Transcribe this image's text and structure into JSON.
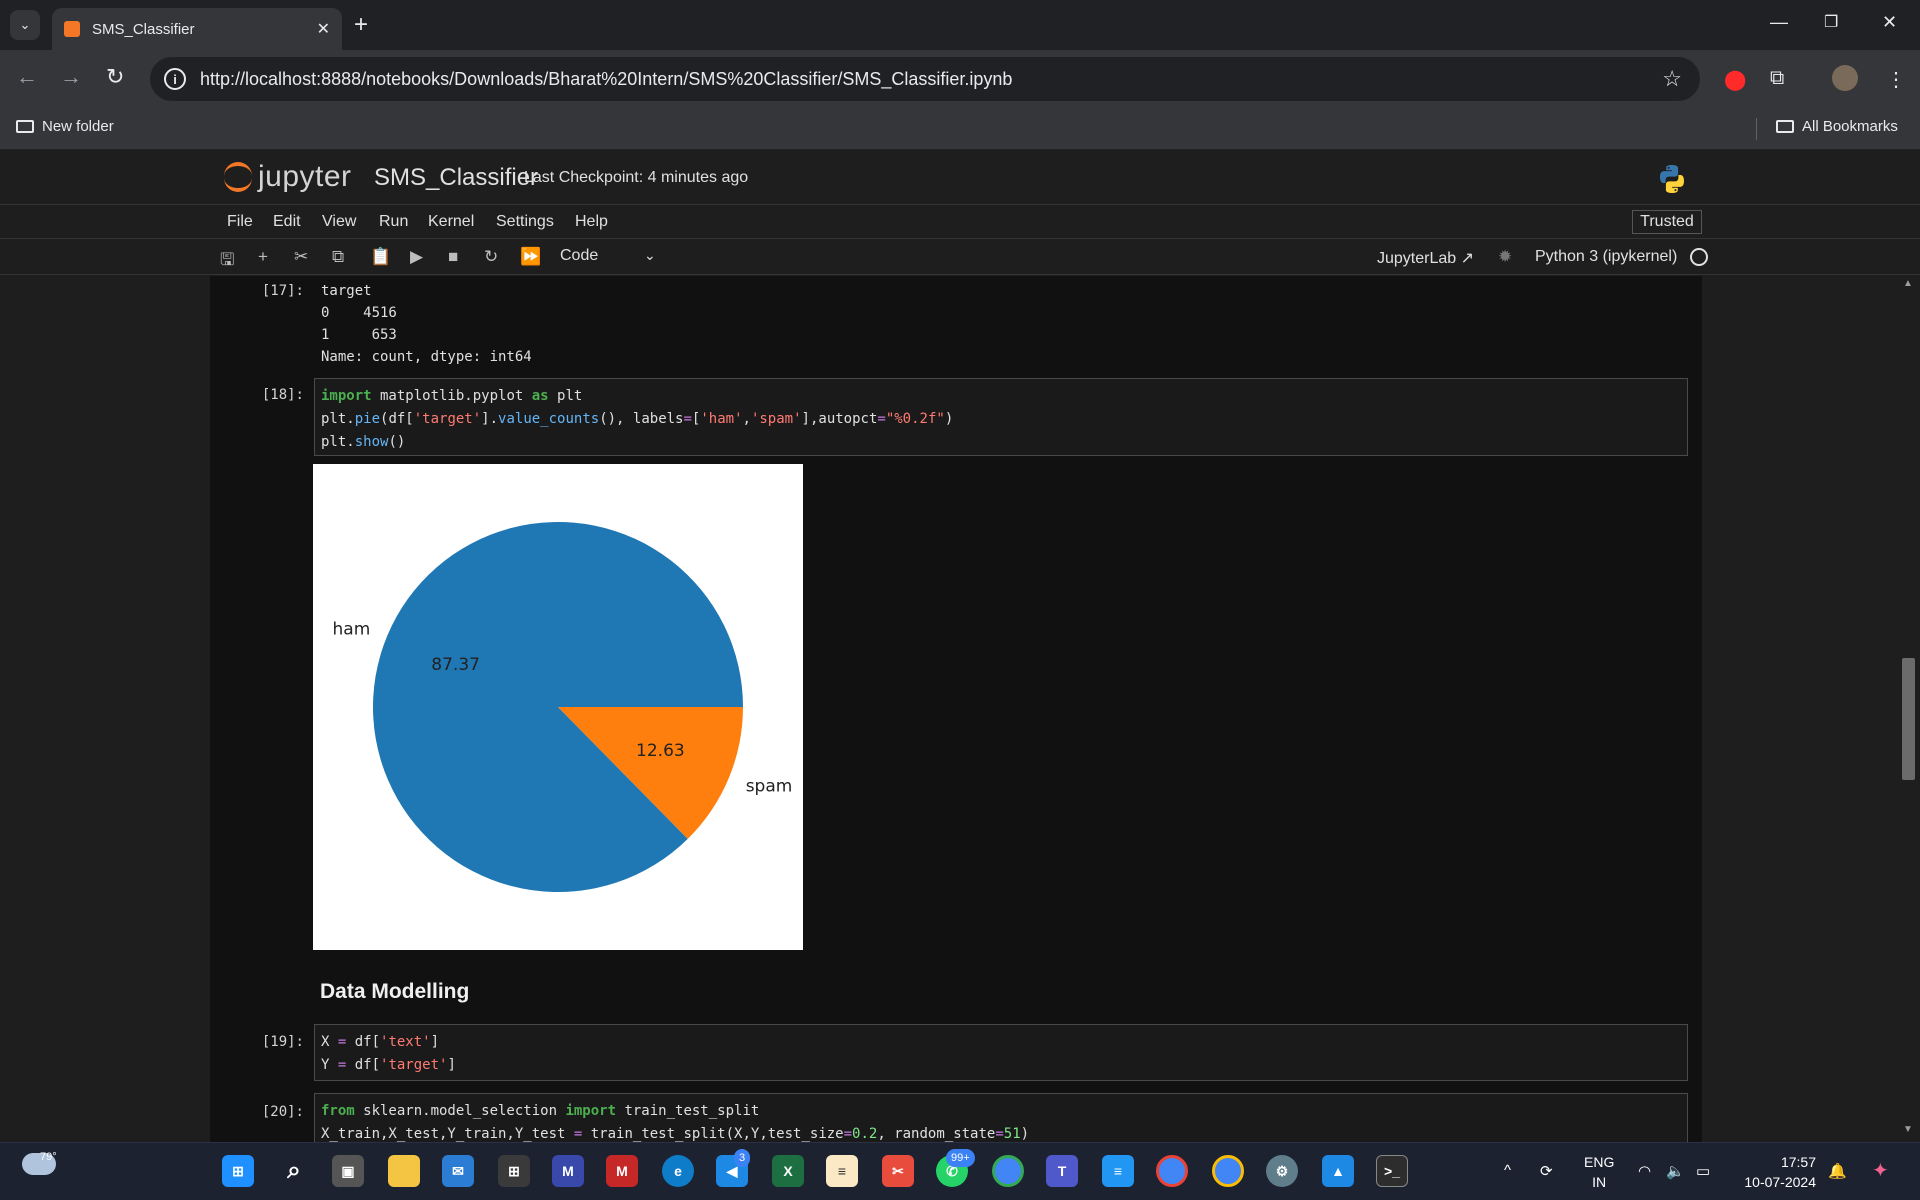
{
  "browser": {
    "tab_title": "SMS_Classifier",
    "url": "http://localhost:8888/notebooks/Downloads/Bharat%20Intern/SMS%20Classifier/SMS_Classifier.ipynb",
    "bookmarks": {
      "left": "New folder",
      "right": "All Bookmarks"
    }
  },
  "jupyter": {
    "logo_text": "jupyter",
    "notebook_name": "SMS_Classifier",
    "checkpoint": "Last Checkpoint: 4 minutes ago",
    "menu": [
      "File",
      "Edit",
      "View",
      "Run",
      "Kernel",
      "Settings",
      "Help"
    ],
    "trusted": "Trusted",
    "cell_type": "Code",
    "jupyterlab_link": "JupyterLab",
    "kernel": "Python 3 (ipykernel)"
  },
  "cells": {
    "c17": {
      "prompt": "[17]:",
      "output": "target\n0    4516\n1     653\nName: count, dtype: int64"
    },
    "c18": {
      "prompt": "[18]:"
    },
    "c19": {
      "prompt": "[19]:"
    },
    "c20": {
      "prompt": "[20]:"
    },
    "markdown_heading": "Data Modelling"
  },
  "chart_data": {
    "type": "pie",
    "categories": [
      "ham",
      "spam"
    ],
    "values": [
      87.37,
      12.63
    ],
    "labels": [
      "87.37",
      "12.63"
    ],
    "colors": [
      "#1f77b4",
      "#ff7f0e"
    ],
    "title": ""
  },
  "taskbar": {
    "temperature": "79°",
    "badges": {
      "vscode": "3",
      "whatsapp": "99+"
    },
    "lang_line1": "ENG",
    "lang_line2": "IN",
    "time": "17:57",
    "date": "10-07-2024"
  }
}
